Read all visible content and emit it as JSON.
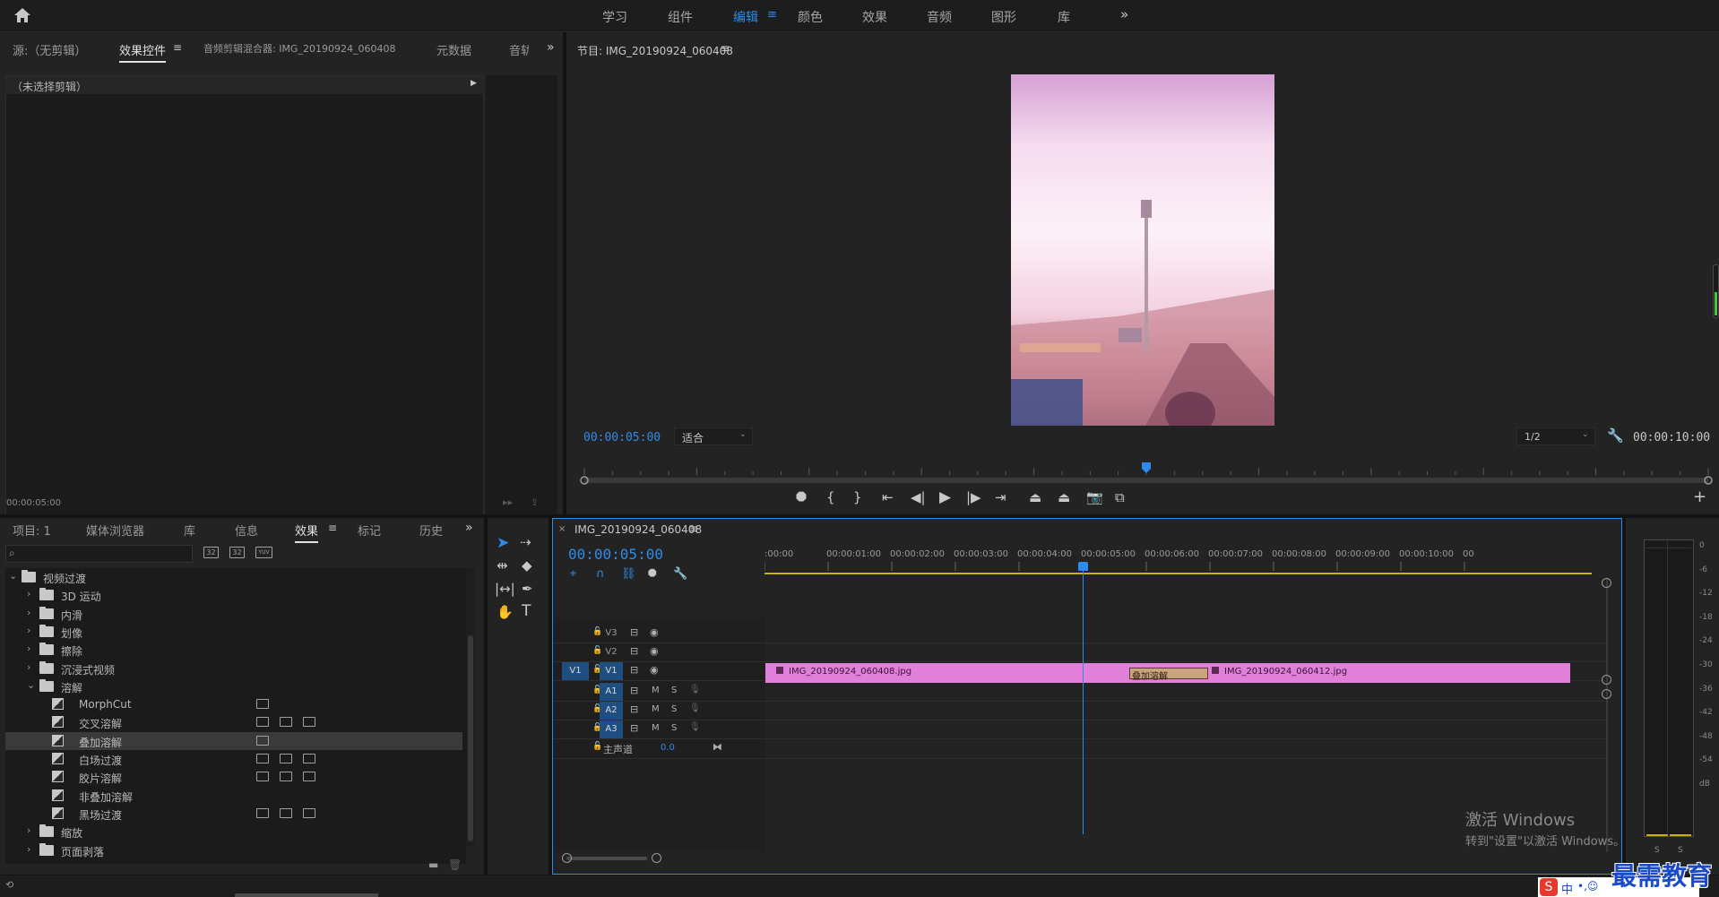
{
  "workspaces": {
    "tabs": [
      "学习",
      "组件",
      "编辑",
      "颜色",
      "效果",
      "音频",
      "图形",
      "库"
    ],
    "active": "编辑",
    "more": "»"
  },
  "source_panel": {
    "tabs": [
      "源:（无剪辑）",
      "效果控件",
      "音频剪辑混合器: IMG_20190924_060408",
      "元数据",
      "音轨"
    ],
    "active": "效果控件",
    "no_clip": "（未选择剪辑）",
    "timecode": "00:00:05:00"
  },
  "program_monitor": {
    "title": "节目: IMG_20190924_060408",
    "timecode": "00:00:05:00",
    "fit": "适合",
    "resolution": "1/2",
    "duration": "00:00:10:00",
    "playhead_fraction": 0.5
  },
  "project_panel": {
    "tabs": [
      "项目: 1",
      "媒体浏览器",
      "库",
      "信息",
      "效果",
      "标记",
      "历史"
    ],
    "active": "效果",
    "search_placeholder": "",
    "filter_badges": [
      "32",
      "32",
      "YUV"
    ],
    "tree": [
      {
        "label": "视频过渡",
        "type": "folder",
        "level": 0,
        "expanded": true
      },
      {
        "label": "3D 运动",
        "type": "folder",
        "level": 1
      },
      {
        "label": "内滑",
        "type": "folder",
        "level": 1
      },
      {
        "label": "划像",
        "type": "folder",
        "level": 1
      },
      {
        "label": "擦除",
        "type": "folder",
        "level": 1
      },
      {
        "label": "沉浸式视频",
        "type": "folder",
        "level": 1
      },
      {
        "label": "溶解",
        "type": "folder",
        "level": 1,
        "expanded": true
      },
      {
        "label": "MorphCut",
        "type": "effect",
        "level": 2,
        "badges": 1
      },
      {
        "label": "交叉溶解",
        "type": "effect",
        "level": 2,
        "badges": 3
      },
      {
        "label": "叠加溶解",
        "type": "effect",
        "level": 2,
        "badges": 1,
        "selected": true
      },
      {
        "label": "白场过渡",
        "type": "effect",
        "level": 2,
        "badges": 3
      },
      {
        "label": "胶片溶解",
        "type": "effect",
        "level": 2,
        "badges": 3
      },
      {
        "label": "非叠加溶解",
        "type": "effect",
        "level": 2,
        "badges": 0
      },
      {
        "label": "黑场过渡",
        "type": "effect",
        "level": 2,
        "badges": 3
      },
      {
        "label": "缩放",
        "type": "folder",
        "level": 1
      },
      {
        "label": "页面剥落",
        "type": "folder",
        "level": 1
      }
    ]
  },
  "timeline": {
    "tab": "IMG_20190924_060408",
    "timecode": "00:00:05:00",
    "ruler": [
      ":00:00",
      "00:00:01:00",
      "00:00:02:00",
      "00:00:03:00",
      "00:00:04:00",
      "00:00:05:00",
      "00:00:06:00",
      "00:00:07:00",
      "00:00:08:00",
      "00:00:09:00",
      "00:00:10:00",
      "00"
    ],
    "video_tracks": [
      "V3",
      "V2",
      "V1"
    ],
    "audio_tracks": [
      "A1",
      "A2",
      "A3"
    ],
    "master": "主声道",
    "master_value": "0.0",
    "clip1": "IMG_20190924_060408.jpg",
    "clip2": "IMG_20190924_060412.jpg",
    "transition": "叠加溶解",
    "mute": "M",
    "solo": "S"
  },
  "meter": {
    "labels": [
      "0",
      "-6",
      "-12",
      "-18",
      "-24",
      "-30",
      "-36",
      "-42",
      "-48",
      "-54",
      "dB"
    ],
    "solo_labels": [
      "S",
      "S"
    ]
  },
  "watermark": {
    "line1": "激活 Windows",
    "line2": "转到\"设置\"以激活 Windows。"
  },
  "brand": {
    "text": "最需教育",
    "ime": "中"
  }
}
